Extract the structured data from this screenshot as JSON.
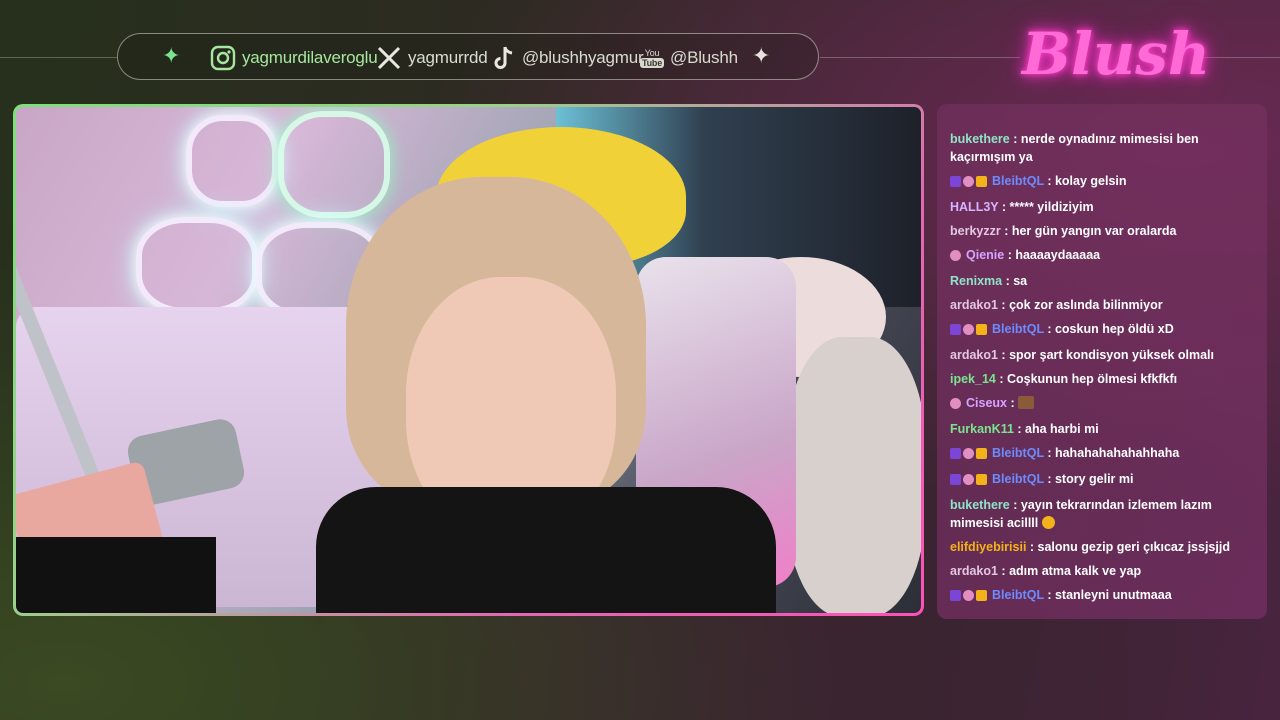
{
  "social": {
    "instagram": "yagmurdilaveroglu",
    "x": "yagmurrdd",
    "tiktok": "@blushhyagmur",
    "youtube_label_top": "You",
    "youtube_label_bottom": "Tube",
    "youtube": "@Blushh"
  },
  "logo": {
    "text": "Blush"
  },
  "video": {
    "scene": "webcam"
  },
  "chat": {
    "messages": [
      {
        "user": "bukethere",
        "color": "#8fe3c6",
        "badges": [],
        "text": "nerde oynadınız mimesisi ben kaçırmışım ya"
      },
      {
        "user": "BleibtQL",
        "color": "#6d8bff",
        "badges": [
          "purple",
          "vip",
          "crown"
        ],
        "text": "kolay gelsin"
      },
      {
        "user": "HALL3Y",
        "color": "#d6b3ff",
        "badges": [],
        "text": "***** yildiziyim"
      },
      {
        "user": "berkyzzr",
        "color": "#e3c6e0",
        "badges": [],
        "text": "her gün yangın var oralarda"
      },
      {
        "user": "Qienie",
        "color": "#d6a3ff",
        "badges": [
          "vip"
        ],
        "text": "haaaaydaaaaa"
      },
      {
        "user": "Renixma",
        "color": "#8fe3c6",
        "badges": [],
        "text": "sa"
      },
      {
        "user": "ardako1",
        "color": "#e3c6e0",
        "badges": [],
        "text": "çok zor aslında bilinmiyor"
      },
      {
        "user": "BleibtQL",
        "color": "#6d8bff",
        "badges": [
          "purple",
          "vip",
          "crown"
        ],
        "text": "coskun hep öldü xD"
      },
      {
        "user": "ardako1",
        "color": "#e3c6e0",
        "badges": [],
        "text": "spor şart kondisyon yüksek olmalı"
      },
      {
        "user": "ipek_14",
        "color": "#7be38e",
        "badges": [],
        "text": "Coşkunun hep ölmesi kfkfkfı"
      },
      {
        "user": "Ciseux",
        "color": "#d6a3ff",
        "badges": [
          "vip"
        ],
        "text": "",
        "emote": "emote"
      },
      {
        "user": "FurkanK11",
        "color": "#7be38e",
        "badges": [],
        "text": "aha harbi mi"
      },
      {
        "user": "BleibtQL",
        "color": "#6d8bff",
        "badges": [
          "purple",
          "vip",
          "crown"
        ],
        "text": "hahahahahahahhaha"
      },
      {
        "user": "BleibtQL",
        "color": "#6d8bff",
        "badges": [
          "purple",
          "vip",
          "crown"
        ],
        "text": "story gelir mi"
      },
      {
        "user": "bukethere",
        "color": "#8fe3c6",
        "badges": [],
        "text": "yayın tekrarından izlemem lazım mimesisi acillll",
        "emoji": "grinning-emoji"
      },
      {
        "user": "elifdiyebirisii",
        "color": "#f3b21a",
        "badges": [],
        "text": "salonu gezip geri çıkıcaz jssjsjjd"
      },
      {
        "user": "ardako1",
        "color": "#e3c6e0",
        "badges": [],
        "text": "adım atma kalk ve yap"
      },
      {
        "user": "BleibtQL",
        "color": "#6d8bff",
        "badges": [
          "purple",
          "vip",
          "crown"
        ],
        "text": "stanleyni unutmaaa"
      }
    ]
  }
}
